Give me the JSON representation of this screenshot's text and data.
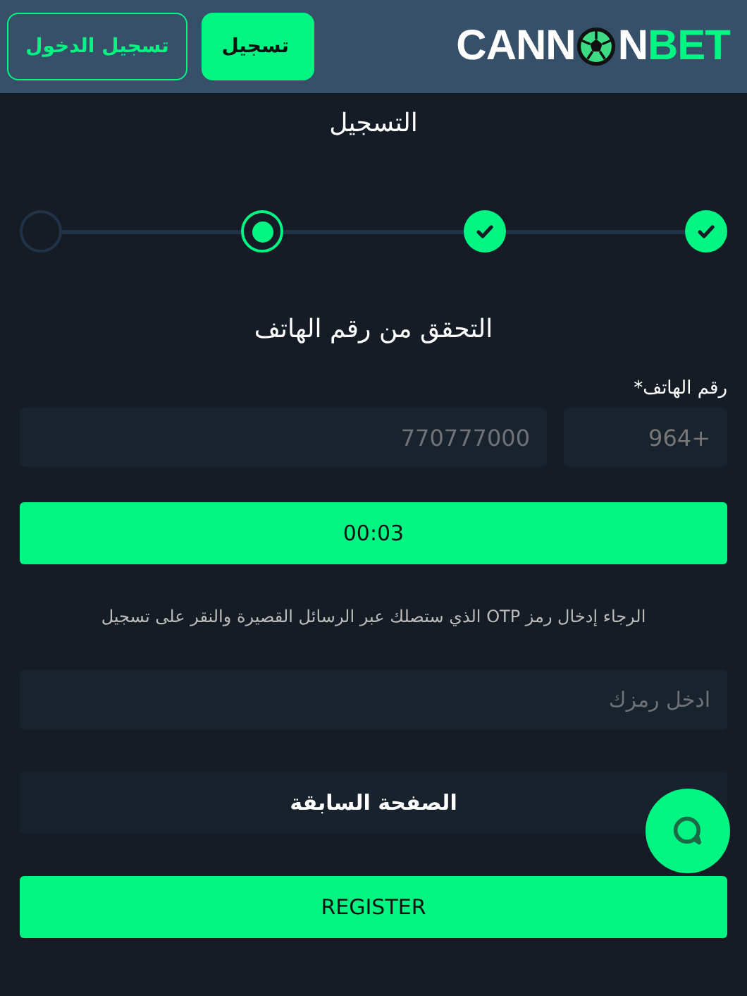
{
  "header": {
    "logo": {
      "before_ball": "CANN",
      "after_ball": "N",
      "accent": "BET"
    },
    "buttons": [
      {
        "label": "تسجيل",
        "kind": "primary"
      },
      {
        "label": "تسجيل الدخول",
        "kind": "outline"
      }
    ]
  },
  "page_title": "التسجيل",
  "steps": [
    {
      "done": true,
      "selected": false
    },
    {
      "done": true,
      "selected": false
    },
    {
      "done": false,
      "selected": true
    },
    {
      "done": false,
      "selected": false
    }
  ],
  "section_title": "التحقق من رقم الهاتف",
  "phone": {
    "label": "رقم الهاتف",
    "required_mark": "*",
    "country_code": "964+",
    "placeholder": "770777000"
  },
  "timer_button": "00:03",
  "instruction": "الرجاء إدخال رمز OTP الذي ستصلك عبر الرسائل القصيرة والنقر على تسجيل",
  "otp_field": {
    "placeholder": "ادخل رمزك"
  },
  "back_button": "الصفحة السابقة",
  "register_button": "REGISTER"
}
